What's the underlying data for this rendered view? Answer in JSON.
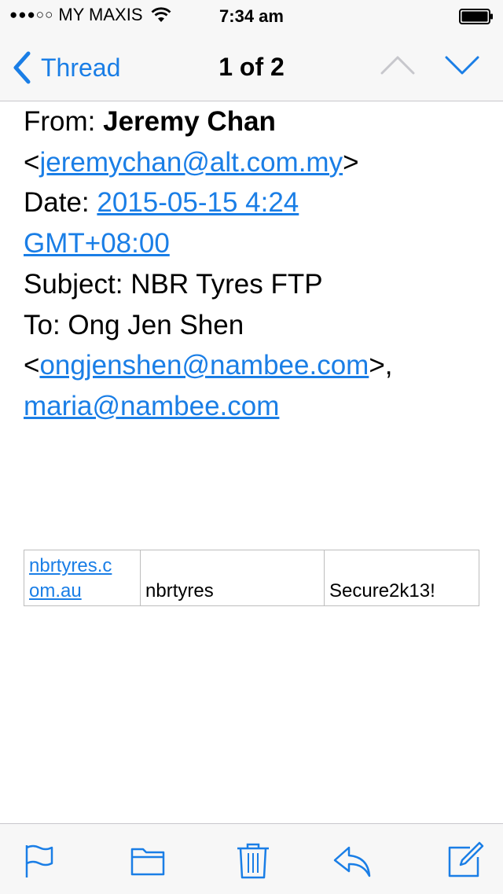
{
  "status_bar": {
    "signal": "●●●○○",
    "carrier": "MY MAXIS",
    "time": "7:34 am"
  },
  "nav": {
    "back_label": "Thread",
    "pager": "1 of 2"
  },
  "email": {
    "from_label": "From: ",
    "from_name": "Jeremy Chan",
    "from_email": "jeremychan@alt.com.my",
    "date_label": "Date: ",
    "date_line1": "2015-05-15 4:24",
    "date_line2": "GMT+08:00",
    "subject_label": "Subject: ",
    "subject": "NBR Tyres FTP",
    "to_label": "To: ",
    "to_name": "Ong Jen Shen",
    "to_email": "ongjenshen@nambee.com",
    "cc_email": "maria@nambee.com"
  },
  "table": {
    "host_line1": "nbrtyres.c",
    "host_line2": "om.au",
    "username": "nbrtyres",
    "password": "Secure2k13!"
  },
  "toolbar": {
    "icons": [
      "flag-icon",
      "folder-icon",
      "trash-icon",
      "reply-icon",
      "compose-icon"
    ]
  },
  "colors": {
    "accent": "#1a7ee6",
    "disabled": "#c7c7cc"
  }
}
